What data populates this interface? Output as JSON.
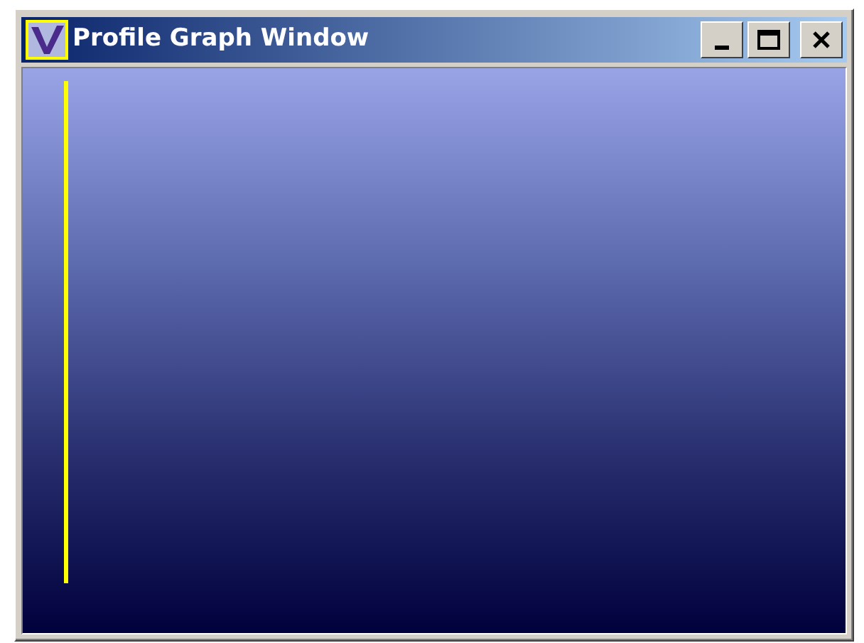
{
  "window": {
    "title": "Profile Graph Window"
  }
}
